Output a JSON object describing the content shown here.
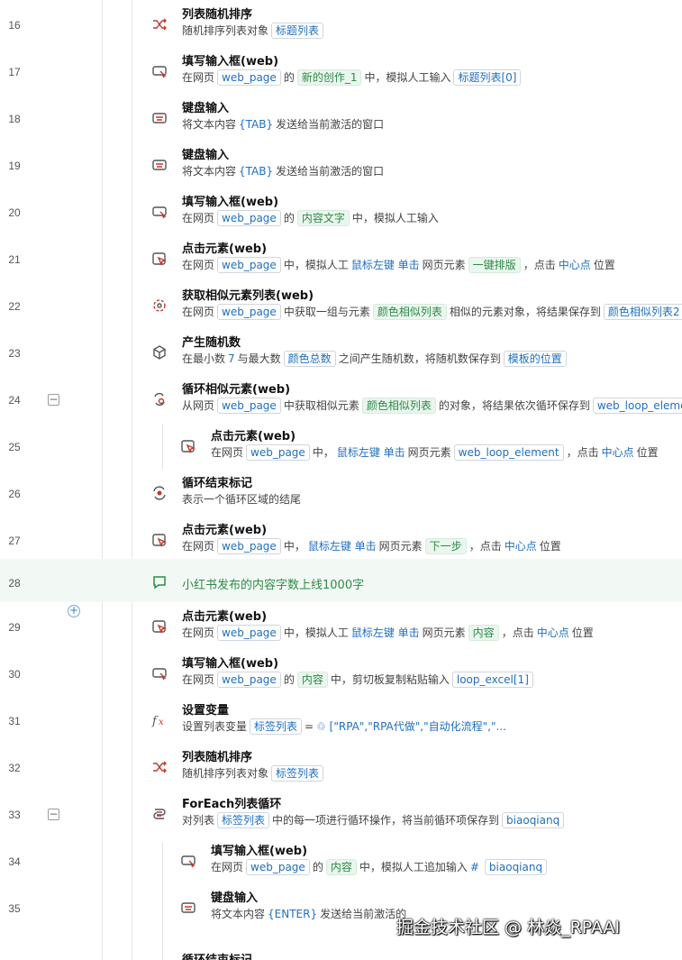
{
  "rows": [
    {
      "n": "16",
      "title": "列表随机排序",
      "desc": [
        [
          "t",
          "随机排序列表对象"
        ],
        [
          "b",
          "标题列表"
        ]
      ]
    },
    {
      "n": "17",
      "title": "填写输入框(web)",
      "desc": [
        [
          "t",
          "在网页"
        ],
        [
          "b",
          "web_page"
        ],
        [
          "t",
          "的"
        ],
        [
          "g",
          "新的创作_1"
        ],
        [
          "t",
          "中，模拟人工输入"
        ],
        [
          "b",
          "标题列表[0]"
        ]
      ]
    },
    {
      "n": "18",
      "title": "键盘输入",
      "desc": [
        [
          "t",
          "将文本内容"
        ],
        [
          "c",
          "{TAB}"
        ],
        [
          "t",
          "发送给当前激活的窗口"
        ]
      ]
    },
    {
      "n": "19",
      "title": "键盘输入",
      "desc": [
        [
          "t",
          "将文本内容"
        ],
        [
          "c",
          "{TAB}"
        ],
        [
          "t",
          "发送给当前激活的窗口"
        ]
      ]
    },
    {
      "n": "20",
      "title": "填写输入框(web)",
      "desc": [
        [
          "t",
          "在网页"
        ],
        [
          "b",
          "web_page"
        ],
        [
          "t",
          "的"
        ],
        [
          "g",
          "内容文字"
        ],
        [
          "t",
          "中，模拟人工输入"
        ]
      ]
    },
    {
      "n": "21",
      "title": "点击元素(web)",
      "desc": [
        [
          "t",
          "在网页"
        ],
        [
          "b",
          "web_page"
        ],
        [
          "t",
          "中，模拟人工"
        ],
        [
          "c",
          "鼠标左键 单击"
        ],
        [
          "t",
          "网页元素"
        ],
        [
          "g",
          "一键排版"
        ],
        [
          "t",
          "，点击"
        ],
        [
          "c",
          "中心点"
        ],
        [
          "t",
          "位置"
        ]
      ]
    },
    {
      "n": "22",
      "title": "获取相似元素列表(web)",
      "desc": [
        [
          "t",
          "在网页"
        ],
        [
          "b",
          "web_page"
        ],
        [
          "t",
          "中获取一组与元素"
        ],
        [
          "g",
          "颜色相似列表"
        ],
        [
          "t",
          "相似的元素对象，将结果保存到"
        ],
        [
          "b",
          "颜色相似列表2"
        ]
      ]
    },
    {
      "n": "23",
      "title": "产生随机数",
      "desc": [
        [
          "t",
          "在最小数"
        ],
        [
          "c",
          "7"
        ],
        [
          "t",
          "与最大数"
        ],
        [
          "b",
          "颜色总数"
        ],
        [
          "t",
          "之间产生随机数，将随机数保存到"
        ],
        [
          "b",
          "模板的位置"
        ]
      ]
    },
    {
      "n": "24",
      "title": "循环相似元素(web)",
      "desc": [
        [
          "t",
          "从网页"
        ],
        [
          "b",
          "web_page"
        ],
        [
          "t",
          "中获取相似元素"
        ],
        [
          "g",
          "颜色相似列表"
        ],
        [
          "t",
          "的对象，将结果依次循环保存到"
        ],
        [
          "b",
          "web_loop_eleme"
        ]
      ]
    },
    {
      "n": "25",
      "title": "点击元素(web)",
      "desc": [
        [
          "t",
          "在网页"
        ],
        [
          "b",
          "web_page"
        ],
        [
          "t",
          "中，"
        ],
        [
          "c",
          "鼠标左键 单击"
        ],
        [
          "t",
          "网页元素"
        ],
        [
          "b",
          "web_loop_element"
        ],
        [
          "t",
          "，点击"
        ],
        [
          "c",
          "中心点"
        ],
        [
          "t",
          "位置"
        ]
      ]
    },
    {
      "n": "26",
      "title": "循环结束标记",
      "desc": [
        [
          "t",
          "表示一个循环区域的结尾"
        ]
      ]
    },
    {
      "n": "27",
      "title": "点击元素(web)",
      "desc": [
        [
          "t",
          "在网页"
        ],
        [
          "b",
          "web_page"
        ],
        [
          "t",
          "中，"
        ],
        [
          "c",
          "鼠标左键 单击"
        ],
        [
          "t",
          "网页元素"
        ],
        [
          "g",
          "下一步"
        ],
        [
          "t",
          "，点击"
        ],
        [
          "c",
          "中心点"
        ],
        [
          "t",
          "位置"
        ]
      ]
    },
    {
      "n": "28",
      "comment": "小红书发布的内容字数上线1000字"
    },
    {
      "n": "29",
      "title": "点击元素(web)",
      "desc": [
        [
          "t",
          "在网页"
        ],
        [
          "b",
          "web_page"
        ],
        [
          "t",
          "中，模拟人工"
        ],
        [
          "c",
          "鼠标左键 单击"
        ],
        [
          "t",
          "网页元素"
        ],
        [
          "g",
          "内容"
        ],
        [
          "t",
          "，点击"
        ],
        [
          "c",
          "中心点"
        ],
        [
          "t",
          "位置"
        ]
      ]
    },
    {
      "n": "30",
      "title": "填写输入框(web)",
      "desc": [
        [
          "t",
          "在网页"
        ],
        [
          "b",
          "web_page"
        ],
        [
          "t",
          "的"
        ],
        [
          "g",
          "内容"
        ],
        [
          "t",
          "中，剪切板复制粘贴输入"
        ],
        [
          "b",
          "loop_excel[1]"
        ]
      ]
    },
    {
      "n": "31",
      "title": "设置变量",
      "desc": [
        [
          "t",
          "设置列表变量"
        ],
        [
          "b",
          "标签列表"
        ],
        [
          "t",
          "="
        ],
        [
          "c",
          "♲ [\"RPA\",\"RPA代做\",\"自动化流程\",\"..."
        ]
      ]
    },
    {
      "n": "32",
      "title": "列表随机排序",
      "desc": [
        [
          "t",
          "随机排序列表对象"
        ],
        [
          "b",
          "标签列表"
        ]
      ]
    },
    {
      "n": "33",
      "title": "ForEach列表循环",
      "desc": [
        [
          "t",
          "对列表"
        ],
        [
          "b",
          "标签列表"
        ],
        [
          "t",
          "中的每一项进行循环操作，将当前循环项保存到"
        ],
        [
          "b",
          "biaoqianq"
        ]
      ]
    },
    {
      "n": "34",
      "title": "填写输入框(web)",
      "desc": [
        [
          "t",
          "在网页"
        ],
        [
          "b",
          "web_page"
        ],
        [
          "t",
          "的"
        ],
        [
          "g",
          "内容"
        ],
        [
          "t",
          "中，模拟人工追加输入"
        ],
        [
          "c",
          "#"
        ],
        [
          "b",
          "biaoqianq"
        ]
      ]
    },
    {
      "n": "35",
      "title": "键盘输入",
      "desc": [
        [
          "t",
          "将文本内容"
        ],
        [
          "c",
          "{ENTER}"
        ],
        [
          "t",
          "发送给当前激活的"
        ]
      ]
    }
  ],
  "partial_title": "循环结束标记",
  "watermark": "掘金技术社区 @ 林焱_RPAAI",
  "fold_minus": "−",
  "plus_label": "+"
}
